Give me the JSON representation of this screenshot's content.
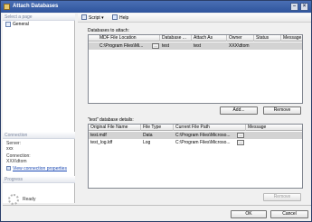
{
  "window": {
    "title": "Attach Databases"
  },
  "left_pane": {
    "select_page_header": "Select a page",
    "pages": [
      {
        "label": "General",
        "icon": "page-icon"
      }
    ],
    "connection_header": "Connection",
    "server_label": "Server:",
    "server_value": "xxx",
    "connection_label": "Connection:",
    "connection_value": "XXX\\dtom",
    "view_connection_link": "View connection properties",
    "progress_header": "Progress",
    "progress_status": "Ready"
  },
  "toolbar": {
    "script_label": "Script",
    "help_label": "Help"
  },
  "databases": {
    "label": "Databases to attach:",
    "columns": [
      "MDF File Location",
      "Database ...",
      "Attach As",
      "Owner",
      "Status",
      "Message"
    ],
    "rows": [
      {
        "mdf": "C:\\Program Files\\Mi...",
        "database": "test",
        "attach_as": "test",
        "owner": "XXX\\dtom",
        "status": "",
        "message": ""
      }
    ],
    "add_button": "Add...",
    "remove_button": "Remove"
  },
  "details": {
    "label": "\"test\" database details:",
    "columns": [
      "Original File Name",
      "File Type",
      "Current File Path",
      "Message"
    ],
    "rows": [
      {
        "name": "test.mdf",
        "type": "Data",
        "path": "C:\\Program Files\\Microso...",
        "message": ""
      },
      {
        "name": "test_log.ldf",
        "type": "Log",
        "path": "C:\\Program Files\\Microso...",
        "message": ""
      }
    ],
    "remove_button": "Remove"
  },
  "footer": {
    "ok_button": "OK",
    "cancel_button": "Cancel"
  },
  "colors": {
    "title_bar": "#2f549c",
    "selection": "#d3d3d3",
    "link": "#1b49b4"
  }
}
